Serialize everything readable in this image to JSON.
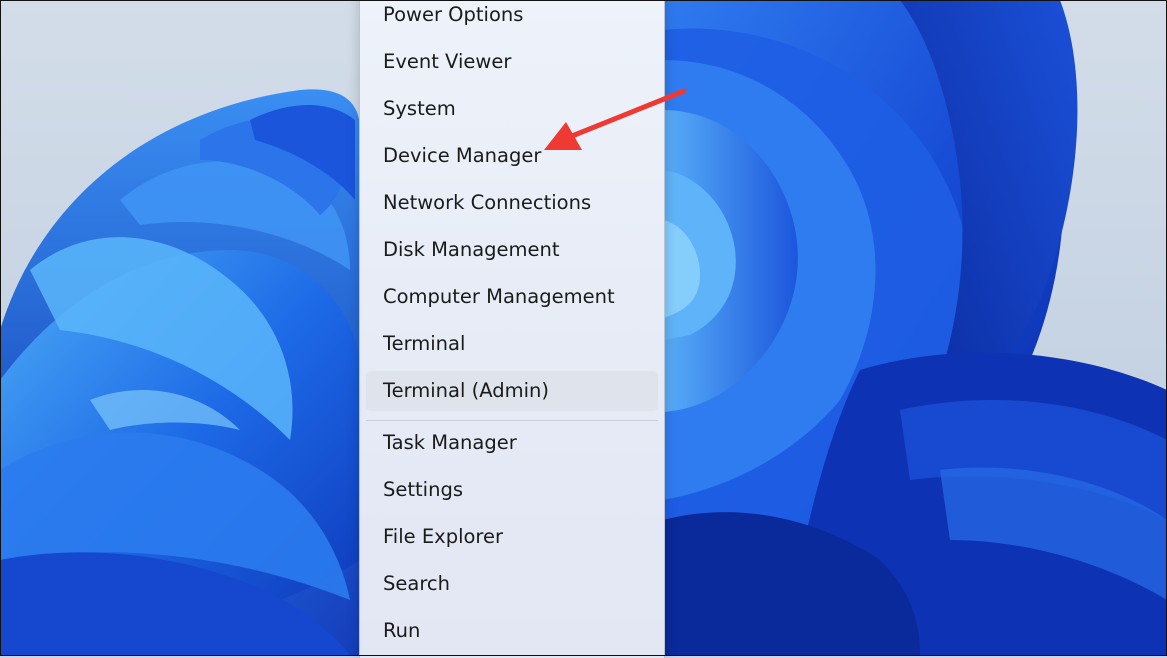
{
  "colors": {
    "desktop_bg": "#c9d6e6",
    "petal_dark": "#0b2fae",
    "petal_mid": "#1f62e6",
    "petal_light": "#49a4f6",
    "menu_bg": "#ebeff8",
    "hover_bg": "#dfe3ec",
    "annotation_arrow": "#ee3a32"
  },
  "context_menu": {
    "groups": [
      [
        "Power Options",
        "Event Viewer",
        "System",
        "Device Manager",
        "Network Connections",
        "Disk Management",
        "Computer Management",
        "Terminal",
        "Terminal (Admin)"
      ],
      [
        "Task Manager",
        "Settings",
        "File Explorer",
        "Search",
        "Run"
      ]
    ],
    "hovered_item": "Terminal (Admin)"
  },
  "annotation": {
    "type": "arrow",
    "points_to": "Device Manager"
  }
}
